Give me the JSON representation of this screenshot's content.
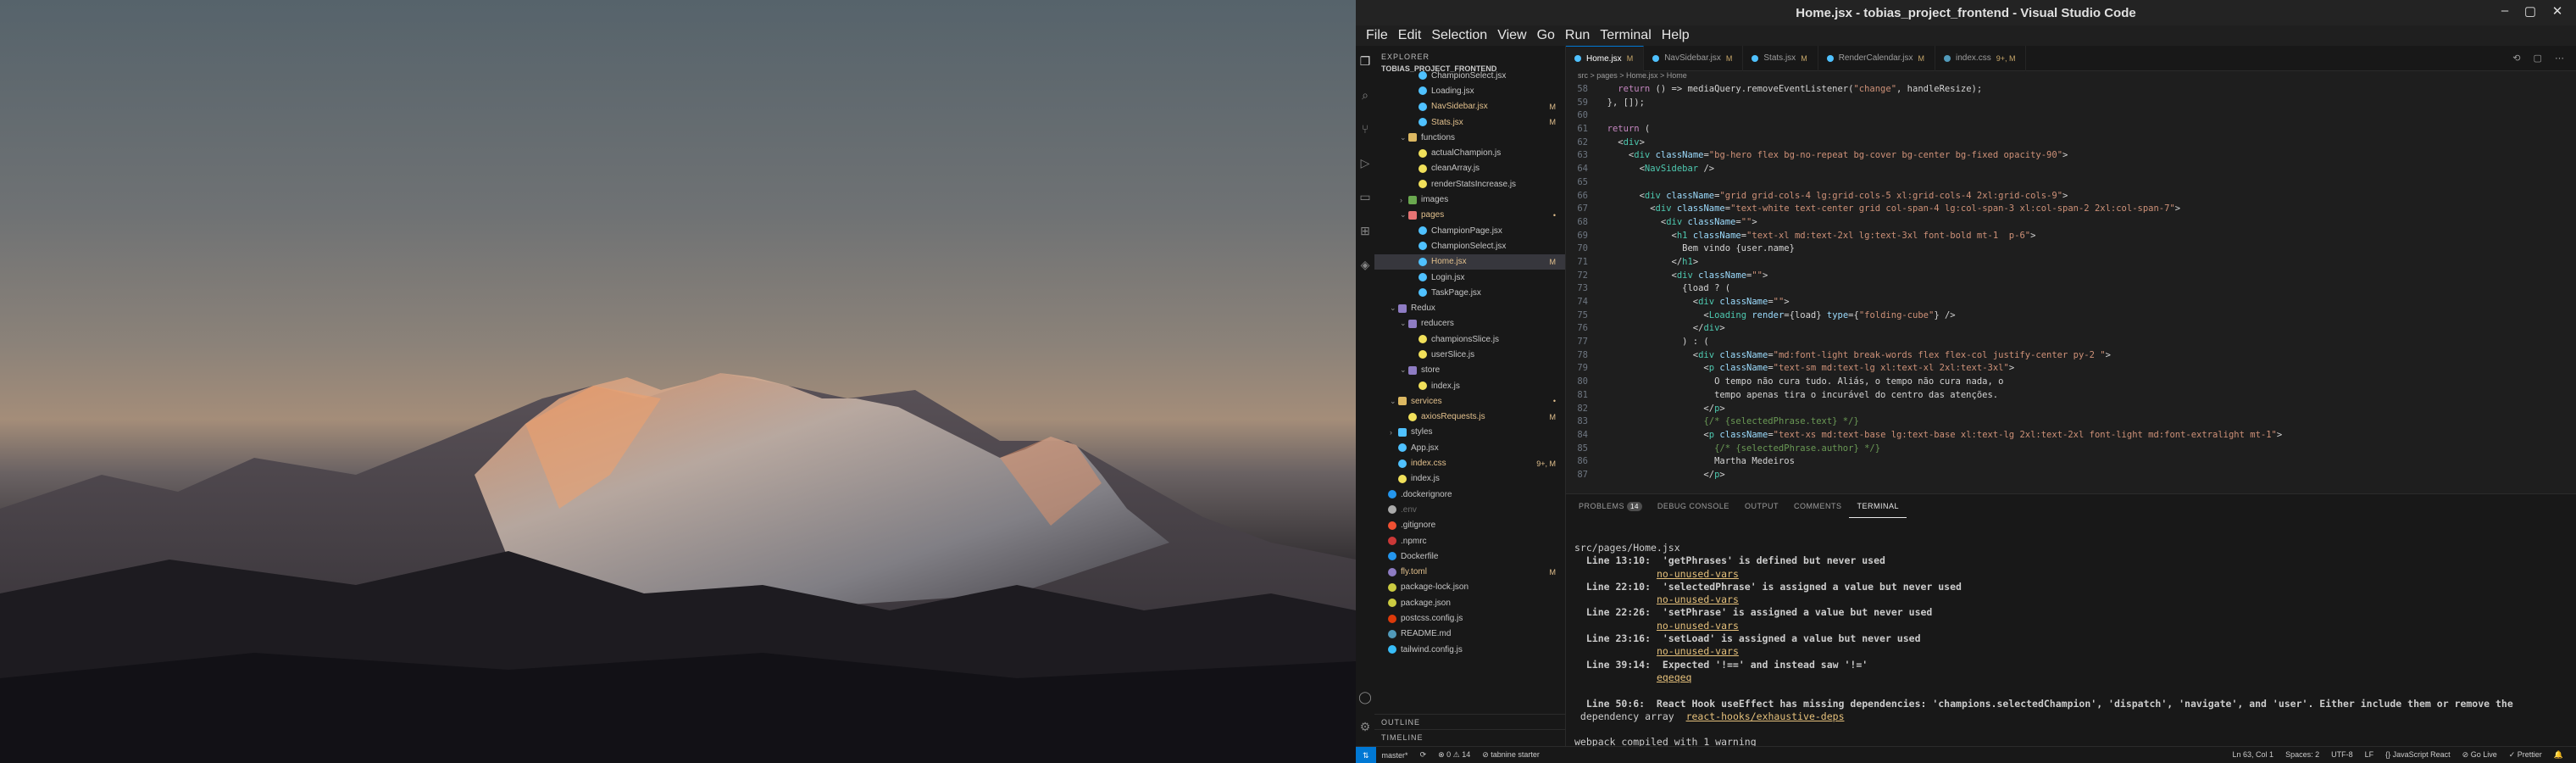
{
  "window": {
    "title": "Home.jsx - tobias_project_frontend - Visual Studio Code",
    "controls": [
      "–",
      "▢",
      "✕"
    ]
  },
  "menu": [
    "File",
    "Edit",
    "Selection",
    "View",
    "Go",
    "Run",
    "Terminal",
    "Help"
  ],
  "sidebar": {
    "header": "EXPLORER",
    "project": "TOBIAS_PROJECT_FRONTEND",
    "tree": [
      {
        "label": "ChampionSelect.jsx",
        "indent": 3,
        "color": "#4fc1ff",
        "badge": "",
        "type": "file"
      },
      {
        "label": "Loading.jsx",
        "indent": 3,
        "color": "#4fc1ff",
        "badge": "",
        "type": "file"
      },
      {
        "label": "NavSidebar.jsx",
        "indent": 3,
        "color": "#4fc1ff",
        "badge": "M",
        "type": "file",
        "mod": true
      },
      {
        "label": "Stats.jsx",
        "indent": 3,
        "color": "#4fc1ff",
        "badge": "M",
        "type": "file",
        "mod": true
      },
      {
        "label": "functions",
        "indent": 2,
        "color": "#dcb862",
        "badge": "",
        "type": "folder",
        "open": true
      },
      {
        "label": "actualChampion.js",
        "indent": 3,
        "color": "#f1e05a",
        "badge": "",
        "type": "file"
      },
      {
        "label": "cleanArray.js",
        "indent": 3,
        "color": "#f1e05a",
        "badge": "",
        "type": "file"
      },
      {
        "label": "renderStatsIncrease.js",
        "indent": 3,
        "color": "#f1e05a",
        "badge": "",
        "type": "file"
      },
      {
        "label": "images",
        "indent": 2,
        "color": "#6aa84f",
        "badge": "",
        "type": "folder"
      },
      {
        "label": "pages",
        "indent": 2,
        "color": "#e57373",
        "badge": "•",
        "type": "folder",
        "open": true,
        "mod": true
      },
      {
        "label": "ChampionPage.jsx",
        "indent": 3,
        "color": "#4fc1ff",
        "badge": "",
        "type": "file"
      },
      {
        "label": "ChampionSelect.jsx",
        "indent": 3,
        "color": "#4fc1ff",
        "badge": "",
        "type": "file"
      },
      {
        "label": "Home.jsx",
        "indent": 3,
        "color": "#4fc1ff",
        "badge": "M",
        "type": "file",
        "mod": true,
        "selected": true
      },
      {
        "label": "Login.jsx",
        "indent": 3,
        "color": "#4fc1ff",
        "badge": "",
        "type": "file"
      },
      {
        "label": "TaskPage.jsx",
        "indent": 3,
        "color": "#4fc1ff",
        "badge": "",
        "type": "file"
      },
      {
        "label": "Redux",
        "indent": 1,
        "color": "#8e7cc3",
        "badge": "",
        "type": "folder",
        "open": true
      },
      {
        "label": "reducers",
        "indent": 2,
        "color": "#8e7cc3",
        "badge": "",
        "type": "folder",
        "open": true
      },
      {
        "label": "championsSlice.js",
        "indent": 3,
        "color": "#f1e05a",
        "badge": "",
        "type": "file"
      },
      {
        "label": "userSlice.js",
        "indent": 3,
        "color": "#f1e05a",
        "badge": "",
        "type": "file"
      },
      {
        "label": "store",
        "indent": 2,
        "color": "#8e7cc3",
        "badge": "",
        "type": "folder",
        "open": true
      },
      {
        "label": "index.js",
        "indent": 3,
        "color": "#f1e05a",
        "badge": "",
        "type": "file"
      },
      {
        "label": "services",
        "indent": 1,
        "color": "#dcb862",
        "badge": "•",
        "type": "folder",
        "open": true,
        "mod": true
      },
      {
        "label": "axiosRequests.js",
        "indent": 2,
        "color": "#f1e05a",
        "badge": "M",
        "type": "file",
        "mod": true
      },
      {
        "label": "styles",
        "indent": 1,
        "color": "#4fc1ff",
        "badge": "",
        "type": "folder"
      },
      {
        "label": "App.jsx",
        "indent": 1,
        "color": "#4fc1ff",
        "badge": "",
        "type": "file"
      },
      {
        "label": "index.css",
        "indent": 1,
        "color": "#4fc1ff",
        "badge": "9+, M",
        "type": "file",
        "mod": true
      },
      {
        "label": "index.js",
        "indent": 1,
        "color": "#f1e05a",
        "badge": "",
        "type": "file"
      },
      {
        "label": ".dockerignore",
        "indent": 0,
        "color": "#2496ed",
        "badge": "",
        "type": "file"
      },
      {
        "label": ".env",
        "indent": 0,
        "color": "#aaaaaa",
        "badge": "",
        "type": "file",
        "dim": true
      },
      {
        "label": ".gitignore",
        "indent": 0,
        "color": "#f05032",
        "badge": "",
        "type": "file"
      },
      {
        "label": ".npmrc",
        "indent": 0,
        "color": "#cb3837",
        "badge": "",
        "type": "file"
      },
      {
        "label": "Dockerfile",
        "indent": 0,
        "color": "#2496ed",
        "badge": "",
        "type": "file"
      },
      {
        "label": "fly.toml",
        "indent": 0,
        "color": "#8e7cc3",
        "badge": "M",
        "type": "file",
        "mod": true
      },
      {
        "label": "package-lock.json",
        "indent": 0,
        "color": "#cbcb41",
        "badge": "",
        "type": "file"
      },
      {
        "label": "package.json",
        "indent": 0,
        "color": "#cbcb41",
        "badge": "",
        "type": "file"
      },
      {
        "label": "postcss.config.js",
        "indent": 0,
        "color": "#dd3a0a",
        "badge": "",
        "type": "file"
      },
      {
        "label": "README.md",
        "indent": 0,
        "color": "#519aba",
        "badge": "",
        "type": "file"
      },
      {
        "label": "tailwind.config.js",
        "indent": 0,
        "color": "#38bdf8",
        "badge": "",
        "type": "file"
      }
    ],
    "footer": [
      "OUTLINE",
      "TIMELINE"
    ]
  },
  "tabs": [
    {
      "label": "Home.jsx",
      "mod": "M",
      "active": true
    },
    {
      "label": "NavSidebar.jsx",
      "mod": "M"
    },
    {
      "label": "Stats.jsx",
      "mod": "M"
    },
    {
      "label": "RenderCalendar.jsx",
      "mod": "M"
    },
    {
      "label": "index.css",
      "mod": "9+, M"
    }
  ],
  "breadcrumb": "src > pages > Home.jsx > Home",
  "code": [
    {
      "n": "58",
      "t": "    return () => mediaQuery.removeEventListener(\"change\", handleResize);"
    },
    {
      "n": "59",
      "t": "  }, []);"
    },
    {
      "n": "60",
      "t": ""
    },
    {
      "n": "61",
      "t": "  return ("
    },
    {
      "n": "62",
      "t": "    <div>"
    },
    {
      "n": "63",
      "t": "      <div className=\"bg-hero flex bg-no-repeat bg-cover bg-center bg-fixed opacity-90\">"
    },
    {
      "n": "64",
      "t": "        <NavSidebar />"
    },
    {
      "n": "65",
      "t": ""
    },
    {
      "n": "66",
      "t": "        <div className=\"grid grid-cols-4 lg:grid-cols-5 xl:grid-cols-4 2xl:grid-cols-9\">"
    },
    {
      "n": "67",
      "t": "          <div className=\"text-white text-center grid col-span-4 lg:col-span-3 xl:col-span-2 2xl:col-span-7\">"
    },
    {
      "n": "68",
      "t": "            <div className=\"\">"
    },
    {
      "n": "69",
      "t": "              <h1 className=\"text-xl md:text-2xl lg:text-3xl font-bold mt-1  p-6\">"
    },
    {
      "n": "70",
      "t": "                Bem vindo {user.name}"
    },
    {
      "n": "71",
      "t": "              </h1>"
    },
    {
      "n": "72",
      "t": "              <div className=\"\">"
    },
    {
      "n": "73",
      "t": "                {load ? ("
    },
    {
      "n": "74",
      "t": "                  <div className=\"\">"
    },
    {
      "n": "75",
      "t": "                    <Loading render={load} type={\"folding-cube\"} />"
    },
    {
      "n": "76",
      "t": "                  </div>"
    },
    {
      "n": "77",
      "t": "                ) : ("
    },
    {
      "n": "78",
      "t": "                  <div className=\"md:font-light break-words flex flex-col justify-center py-2 \">"
    },
    {
      "n": "79",
      "t": "                    <p className=\"text-sm md:text-lg xl:text-xl 2xl:text-3xl\">"
    },
    {
      "n": "80",
      "t": "                      O tempo não cura tudo. Aliás, o tempo não cura nada, o"
    },
    {
      "n": "81",
      "t": "                      tempo apenas tira o incurável do centro das atenções."
    },
    {
      "n": "82",
      "t": "                    </p>"
    },
    {
      "n": "83",
      "t": "                    {/* {selectedPhrase.text} */}"
    },
    {
      "n": "84",
      "t": "                    <p className=\"text-xs md:text-base lg:text-base xl:text-lg 2xl:text-2xl font-light md:font-extralight mt-1\">"
    },
    {
      "n": "85",
      "t": "                      {/* {selectedPhrase.author} */}"
    },
    {
      "n": "86",
      "t": "                      Martha Medeiros"
    },
    {
      "n": "87",
      "t": "                    </p>"
    }
  ],
  "panel": {
    "tabs": [
      {
        "label": "PROBLEMS",
        "count": "14"
      },
      {
        "label": "DEBUG CONSOLE"
      },
      {
        "label": "OUTPUT"
      },
      {
        "label": "COMMENTS"
      },
      {
        "label": "TERMINAL",
        "active": true
      }
    ],
    "terminal": [
      {
        "t": "src/pages/Home.jsx"
      },
      {
        "t": "  Line 13:10:  'getPhrases' is defined but never used"
      },
      {
        "t": "              ",
        "u": "no-unused-vars"
      },
      {
        "t": "  Line 22:10:  'selectedPhrase' is assigned a value but never used"
      },
      {
        "t": "              ",
        "u": "no-unused-vars"
      },
      {
        "t": "  Line 22:26:  'setPhrase' is assigned a value but never used"
      },
      {
        "t": "              ",
        "u": "no-unused-vars"
      },
      {
        "t": "  Line 23:16:  'setLoad' is assigned a value but never used"
      },
      {
        "t": "              ",
        "u": "no-unused-vars"
      },
      {
        "t": "  Line 39:14:  Expected '!==' and instead saw '!='"
      },
      {
        "t": "              ",
        "u": "eqeqeq"
      },
      {
        "t": ""
      },
      {
        "t": "  Line 50:6:  React Hook useEffect has missing dependencies: 'champions.selectedChampion', 'dispatch', 'navigate', and 'user'. Either include them or remove the"
      },
      {
        "t": " dependency array  ",
        "u": "react-hooks/exhaustive-deps"
      },
      {
        "t": ""
      },
      {
        "t": "webpack compiled with 1 warning"
      },
      {
        "t": "▯"
      }
    ]
  },
  "statusbar": {
    "left": [
      "master*",
      "⟳",
      "⊗ 0 ⚠ 14",
      "⊘ tabnine starter"
    ],
    "right": [
      "Ln 63, Col 1",
      "Spaces: 2",
      "UTF-8",
      "LF",
      "{} JavaScript React",
      "⊘ Go Live",
      "✓ Prettier",
      "🔔"
    ]
  }
}
